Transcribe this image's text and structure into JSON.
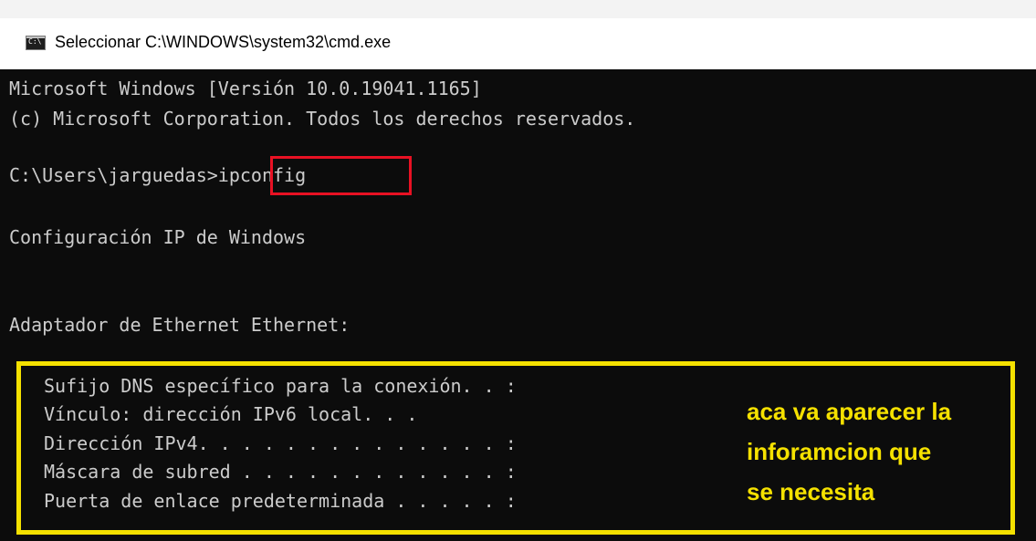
{
  "window": {
    "title": "Seleccionar C:\\WINDOWS\\system32\\cmd.exe",
    "icon_label": "C:\\",
    "icon": "cmd-icon"
  },
  "console": {
    "lines": [
      "Microsoft Windows [Versión 10.0.19041.1165]",
      "(c) Microsoft Corporation. Todos los derechos reservados.",
      "C:\\Users\\jarguedas>ipconfig",
      "Configuración IP de Windows",
      "Adaptador de Ethernet Ethernet:"
    ],
    "ipconfig_fields": [
      "Sufijo DNS específico para la conexión. . :",
      "Vínculo: dirección IPv6 local. . .",
      "Dirección IPv4. . . . . . . . . . . . . . :",
      "Máscara de subred . . . . . . . . . . . . :",
      "Puerta de enlace predeterminada . . . . . :"
    ]
  },
  "annotation": {
    "lines": [
      "aca va aparecer la",
      "inforamcion que",
      "se necesita"
    ]
  },
  "colors": {
    "console_bg": "#0c0c0c",
    "console_text": "#cccccc",
    "highlight_red": "#e81123",
    "highlight_yellow": "#f5e100"
  }
}
